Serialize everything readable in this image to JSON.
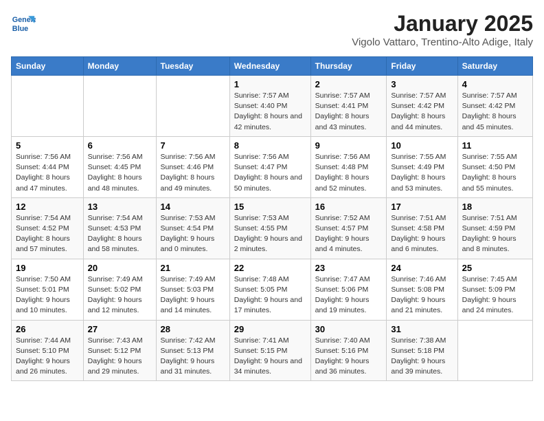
{
  "header": {
    "logo_line1": "General",
    "logo_line2": "Blue",
    "month": "January 2025",
    "location": "Vigolo Vattaro, Trentino-Alto Adige, Italy"
  },
  "days_of_week": [
    "Sunday",
    "Monday",
    "Tuesday",
    "Wednesday",
    "Thursday",
    "Friday",
    "Saturday"
  ],
  "weeks": [
    [
      {
        "num": "",
        "info": ""
      },
      {
        "num": "",
        "info": ""
      },
      {
        "num": "",
        "info": ""
      },
      {
        "num": "1",
        "info": "Sunrise: 7:57 AM\nSunset: 4:40 PM\nDaylight: 8 hours and 42 minutes."
      },
      {
        "num": "2",
        "info": "Sunrise: 7:57 AM\nSunset: 4:41 PM\nDaylight: 8 hours and 43 minutes."
      },
      {
        "num": "3",
        "info": "Sunrise: 7:57 AM\nSunset: 4:42 PM\nDaylight: 8 hours and 44 minutes."
      },
      {
        "num": "4",
        "info": "Sunrise: 7:57 AM\nSunset: 4:42 PM\nDaylight: 8 hours and 45 minutes."
      }
    ],
    [
      {
        "num": "5",
        "info": "Sunrise: 7:56 AM\nSunset: 4:44 PM\nDaylight: 8 hours and 47 minutes."
      },
      {
        "num": "6",
        "info": "Sunrise: 7:56 AM\nSunset: 4:45 PM\nDaylight: 8 hours and 48 minutes."
      },
      {
        "num": "7",
        "info": "Sunrise: 7:56 AM\nSunset: 4:46 PM\nDaylight: 8 hours and 49 minutes."
      },
      {
        "num": "8",
        "info": "Sunrise: 7:56 AM\nSunset: 4:47 PM\nDaylight: 8 hours and 50 minutes."
      },
      {
        "num": "9",
        "info": "Sunrise: 7:56 AM\nSunset: 4:48 PM\nDaylight: 8 hours and 52 minutes."
      },
      {
        "num": "10",
        "info": "Sunrise: 7:55 AM\nSunset: 4:49 PM\nDaylight: 8 hours and 53 minutes."
      },
      {
        "num": "11",
        "info": "Sunrise: 7:55 AM\nSunset: 4:50 PM\nDaylight: 8 hours and 55 minutes."
      }
    ],
    [
      {
        "num": "12",
        "info": "Sunrise: 7:54 AM\nSunset: 4:52 PM\nDaylight: 8 hours and 57 minutes."
      },
      {
        "num": "13",
        "info": "Sunrise: 7:54 AM\nSunset: 4:53 PM\nDaylight: 8 hours and 58 minutes."
      },
      {
        "num": "14",
        "info": "Sunrise: 7:53 AM\nSunset: 4:54 PM\nDaylight: 9 hours and 0 minutes."
      },
      {
        "num": "15",
        "info": "Sunrise: 7:53 AM\nSunset: 4:55 PM\nDaylight: 9 hours and 2 minutes."
      },
      {
        "num": "16",
        "info": "Sunrise: 7:52 AM\nSunset: 4:57 PM\nDaylight: 9 hours and 4 minutes."
      },
      {
        "num": "17",
        "info": "Sunrise: 7:51 AM\nSunset: 4:58 PM\nDaylight: 9 hours and 6 minutes."
      },
      {
        "num": "18",
        "info": "Sunrise: 7:51 AM\nSunset: 4:59 PM\nDaylight: 9 hours and 8 minutes."
      }
    ],
    [
      {
        "num": "19",
        "info": "Sunrise: 7:50 AM\nSunset: 5:01 PM\nDaylight: 9 hours and 10 minutes."
      },
      {
        "num": "20",
        "info": "Sunrise: 7:49 AM\nSunset: 5:02 PM\nDaylight: 9 hours and 12 minutes."
      },
      {
        "num": "21",
        "info": "Sunrise: 7:49 AM\nSunset: 5:03 PM\nDaylight: 9 hours and 14 minutes."
      },
      {
        "num": "22",
        "info": "Sunrise: 7:48 AM\nSunset: 5:05 PM\nDaylight: 9 hours and 17 minutes."
      },
      {
        "num": "23",
        "info": "Sunrise: 7:47 AM\nSunset: 5:06 PM\nDaylight: 9 hours and 19 minutes."
      },
      {
        "num": "24",
        "info": "Sunrise: 7:46 AM\nSunset: 5:08 PM\nDaylight: 9 hours and 21 minutes."
      },
      {
        "num": "25",
        "info": "Sunrise: 7:45 AM\nSunset: 5:09 PM\nDaylight: 9 hours and 24 minutes."
      }
    ],
    [
      {
        "num": "26",
        "info": "Sunrise: 7:44 AM\nSunset: 5:10 PM\nDaylight: 9 hours and 26 minutes."
      },
      {
        "num": "27",
        "info": "Sunrise: 7:43 AM\nSunset: 5:12 PM\nDaylight: 9 hours and 29 minutes."
      },
      {
        "num": "28",
        "info": "Sunrise: 7:42 AM\nSunset: 5:13 PM\nDaylight: 9 hours and 31 minutes."
      },
      {
        "num": "29",
        "info": "Sunrise: 7:41 AM\nSunset: 5:15 PM\nDaylight: 9 hours and 34 minutes."
      },
      {
        "num": "30",
        "info": "Sunrise: 7:40 AM\nSunset: 5:16 PM\nDaylight: 9 hours and 36 minutes."
      },
      {
        "num": "31",
        "info": "Sunrise: 7:38 AM\nSunset: 5:18 PM\nDaylight: 9 hours and 39 minutes."
      },
      {
        "num": "",
        "info": ""
      }
    ]
  ]
}
